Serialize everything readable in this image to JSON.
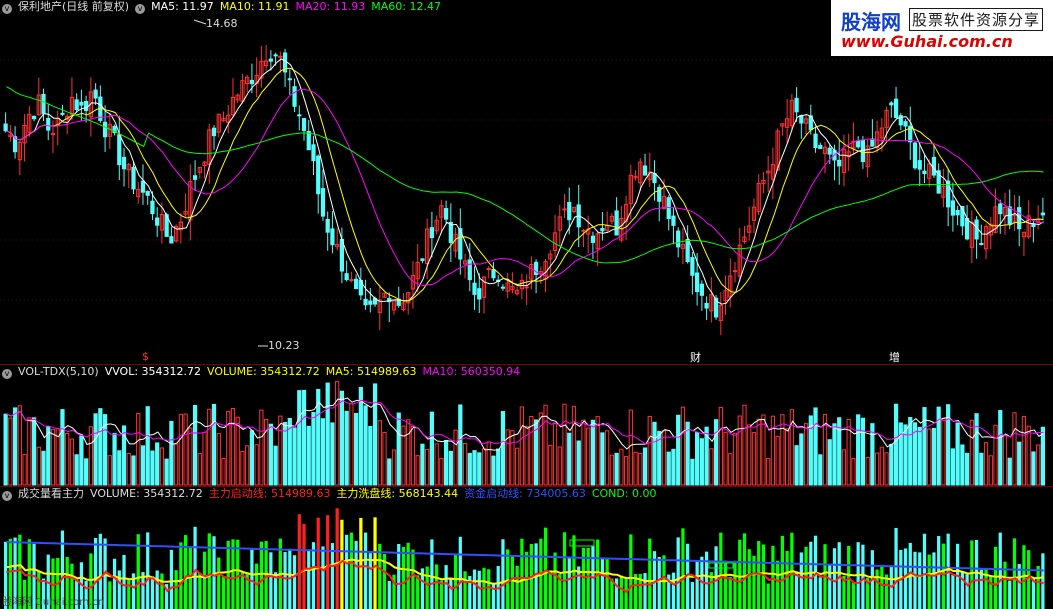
{
  "price_panel": {
    "stock_name": "保利地产(日线 前复权)",
    "ma5": "MA5: 11.97",
    "ma10": "MA10: 11.91",
    "ma20": "MA20: 11.93",
    "ma60": "MA60: 12.47",
    "high_label": "14.68",
    "low_label": "10.23",
    "markers": [
      "$",
      "财",
      "增"
    ],
    "colors": {
      "up": "#ff3232",
      "down": "#54fcfc",
      "ma5": "#ffffff",
      "ma10": "#ffff00",
      "ma20": "#ff00ff",
      "ma60": "#00ff00"
    }
  },
  "volume_panel": {
    "title": "VOL-TDX(5,10)",
    "vvol": "VVOL: 354312.72",
    "volume": "VOLUME: 354312.72",
    "ma5": "MA5: 514989.63",
    "ma10": "MA10: 560350.94"
  },
  "main_force_panel": {
    "title": "成交量看主力",
    "volume": "VOLUME: 354312.72",
    "start_line": "主力启动线: 514989.63",
    "wash_line": "主力洗盘线: 568143.44",
    "capital_line": "资金启动线: 734005.63",
    "cond": "COND: 0.00"
  },
  "logo": {
    "brand": "股海网",
    "subtitle": "股票软件资源分享",
    "url": "www.Guhai.com.cn"
  },
  "watermark": "股海网 Guhai.com.cn",
  "chart_data": {
    "type": "candlestick",
    "price_ylim": [
      10.0,
      14.9
    ],
    "high": {
      "value": 14.68
    },
    "low": {
      "value": 10.23
    },
    "close_path": [
      13.2,
      13.0,
      13.4,
      13.6,
      13.2,
      13.3,
      13.7,
      13.5,
      13.8,
      13.3,
      13.0,
      12.6,
      12.4,
      12.2,
      11.9,
      11.6,
      11.9,
      12.4,
      12.8,
      13.2,
      13.4,
      13.7,
      13.9,
      14.1,
      14.4,
      14.3,
      13.8,
      13.4,
      12.8,
      12.0,
      11.6,
      11.2,
      10.8,
      10.5,
      10.6,
      10.9,
      10.7,
      10.9,
      11.3,
      11.8,
      12.1,
      11.6,
      11.2,
      10.8,
      11.0,
      11.2,
      10.9,
      10.8,
      11.1,
      11.3,
      11.6,
      11.9,
      12.1,
      11.8,
      11.7,
      11.9,
      11.8,
      12.4,
      12.8,
      12.6,
      12.3,
      11.8,
      11.4,
      11.0,
      10.8,
      10.6,
      11.0,
      11.4,
      11.8,
      12.3,
      12.7,
      13.2,
      13.5,
      13.3,
      13.0,
      12.9,
      12.6,
      12.8,
      13.0,
      12.8,
      13.2,
      13.5,
      13.3,
      12.9,
      12.6,
      12.5,
      12.3,
      12.0,
      11.8,
      11.6,
      11.9,
      12.1,
      11.9,
      11.7,
      11.9,
      12.0
    ]
  }
}
